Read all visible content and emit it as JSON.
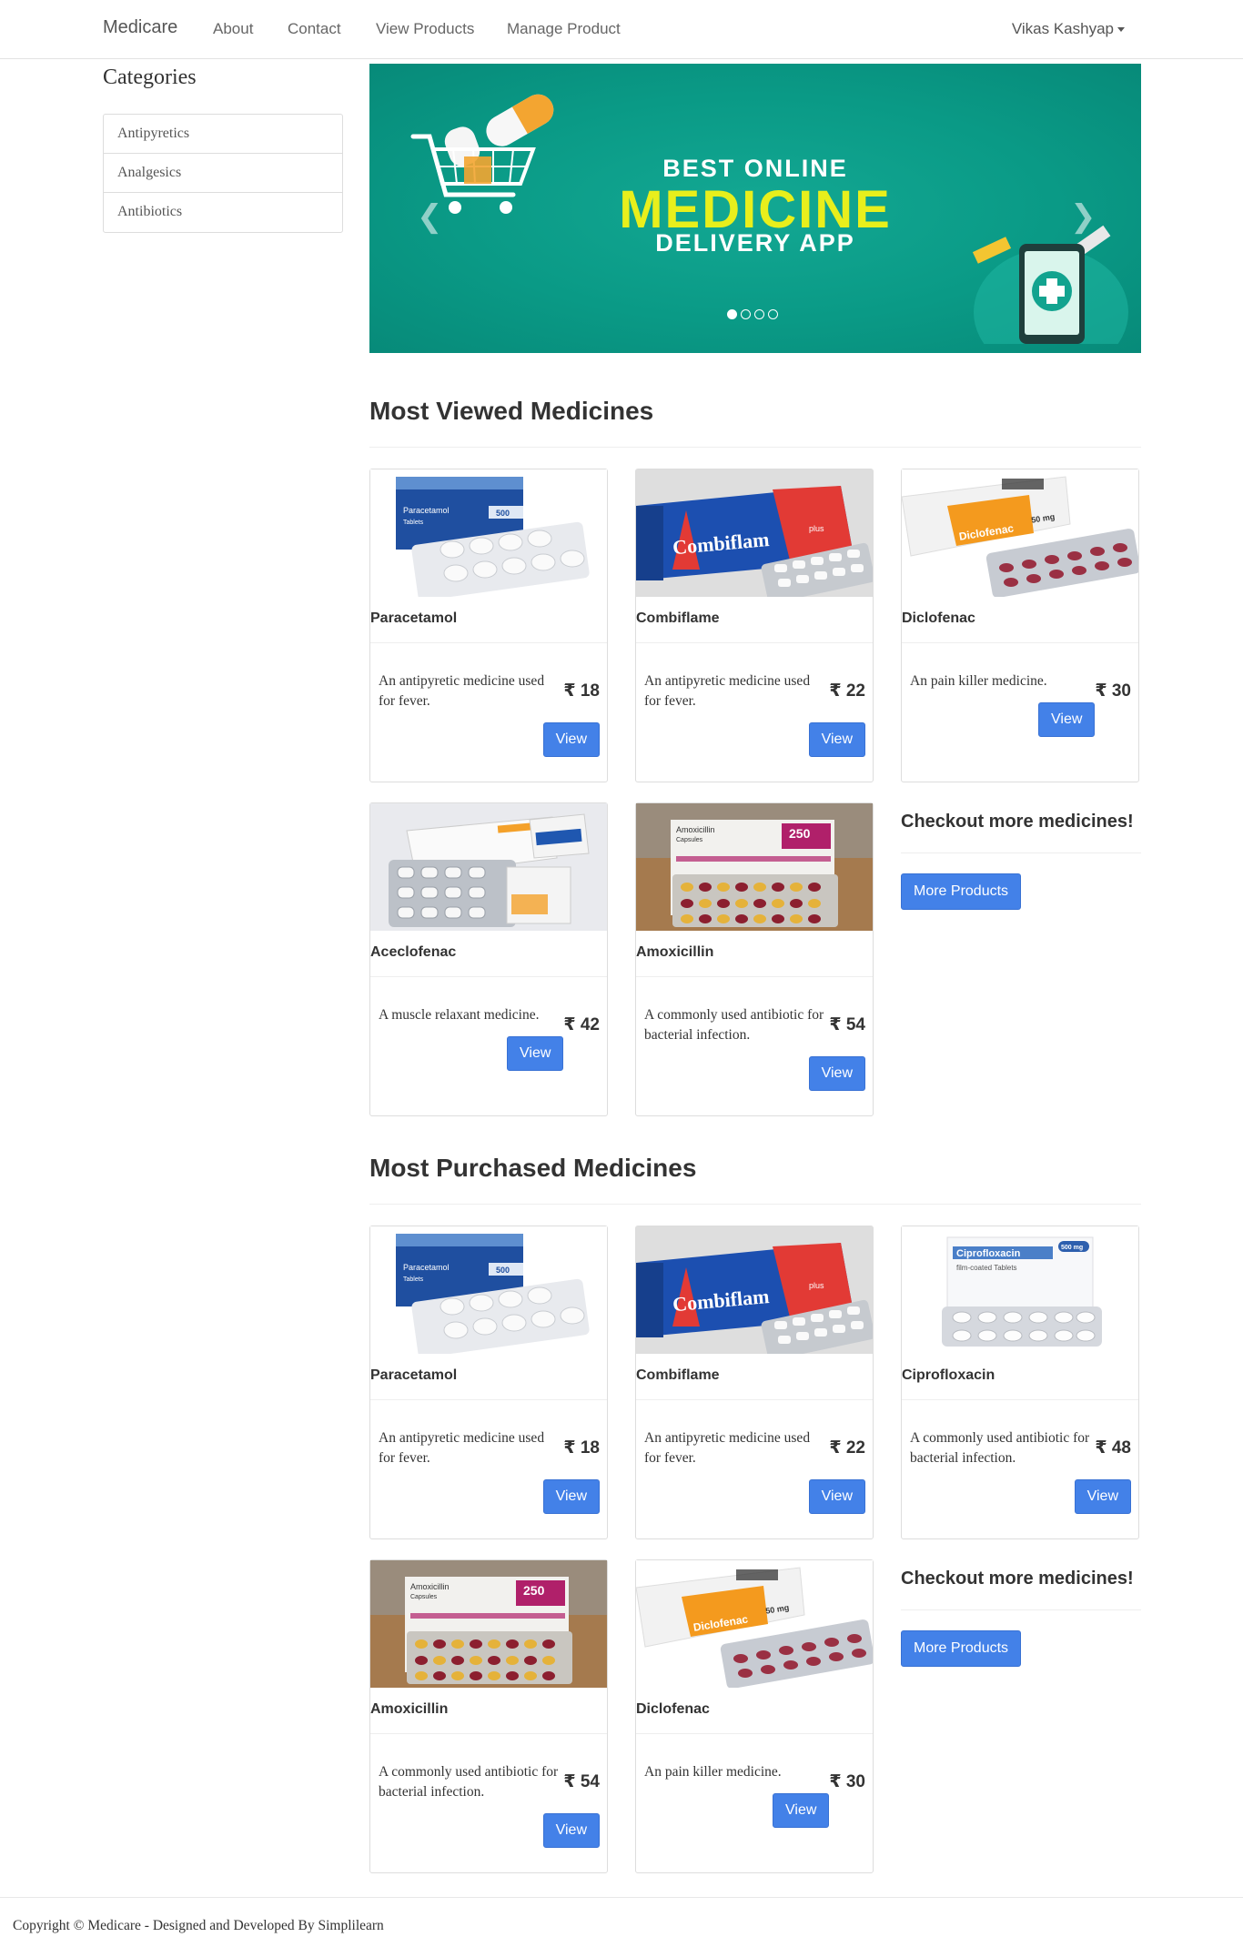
{
  "navbar": {
    "brand": "Medicare",
    "links": [
      "About",
      "Contact",
      "View Products",
      "Manage Product"
    ],
    "user": "Vikas Kashyap"
  },
  "sidebar": {
    "title": "Categories",
    "items": [
      "Antipyretics",
      "Analgesics",
      "Antibiotics"
    ]
  },
  "carousel": {
    "line1": "BEST ONLINE",
    "line2": "MEDICINE",
    "line3": "DELIVERY APP",
    "slide_count": 4,
    "active_slide": 1,
    "prev_icon": "chevron-left-icon",
    "next_icon": "chevron-right-icon"
  },
  "most_viewed": {
    "title": "Most Viewed Medicines",
    "cards": [
      {
        "name": "Paracetamol",
        "desc": "An antipyretic medicine used for fever.",
        "price": "₹ 18",
        "button": "View",
        "image": "paracetamol-box"
      },
      {
        "name": "Combiflame",
        "desc": "An antipyretic medicine used for fever.",
        "price": "₹ 22",
        "button": "View",
        "image": "combiflam-box"
      },
      {
        "name": "Diclofenac",
        "desc": "An pain killer medicine.",
        "price": "₹ 30",
        "button": "View",
        "image": "diclofenac-box"
      },
      {
        "name": "Aceclofenac",
        "desc": "A muscle relaxant medicine.",
        "price": "₹ 42",
        "button": "View",
        "image": "aceclofenac-box"
      },
      {
        "name": "Amoxicillin",
        "desc": "A commonly used antibiotic for bacterial infection.",
        "price": "₹ 54",
        "button": "View",
        "image": "amoxicillin-box"
      }
    ],
    "more_title": "Checkout more medicines!",
    "more_button": "More Products"
  },
  "most_purchased": {
    "title": "Most Purchased Medicines",
    "cards": [
      {
        "name": "Paracetamol",
        "desc": "An antipyretic medicine used for fever.",
        "price": "₹ 18",
        "button": "View",
        "image": "paracetamol-box"
      },
      {
        "name": "Combiflame",
        "desc": "An antipyretic medicine used for fever.",
        "price": "₹ 22",
        "button": "View",
        "image": "combiflam-box"
      },
      {
        "name": "Ciprofloxacin",
        "desc": "A commonly used antibiotic for bacterial infection.",
        "price": "₹ 48",
        "button": "View",
        "image": "ciprofloxacin-box"
      },
      {
        "name": "Amoxicillin",
        "desc": "A commonly used antibiotic for bacterial infection.",
        "price": "₹ 54",
        "button": "View",
        "image": "amoxicillin-box"
      },
      {
        "name": "Diclofenac",
        "desc": "An pain killer medicine.",
        "price": "₹ 30",
        "button": "View",
        "image": "diclofenac-box"
      }
    ],
    "more_title": "Checkout more medicines!",
    "more_button": "More Products"
  },
  "footer": {
    "text": "Copyright © Medicare - Designed and Developed By Simplilearn"
  },
  "colors": {
    "primary_button": "#4381e8",
    "banner_teal": "#0a9a86",
    "banner_yellow": "#e8ef1c"
  },
  "product_image_labels": {
    "paracetamol": "Paracetamol",
    "paracetamol_strength": "500",
    "paracetamol_sub": "Tablets",
    "combiflam": "Combiflam",
    "combiflam_plus": "plus",
    "diclofenac": "Diclofenac",
    "diclofenac_strength": "50 mg",
    "ciprofloxacin": "Ciprofloxacin",
    "ciprofloxacin_strength": "500 mg",
    "ciprofloxacin_sub": "film-coated Tablets",
    "amoxicillin": "Amoxicillin",
    "amoxicillin_sub": "Capsules",
    "amoxicillin_strength": "250"
  }
}
